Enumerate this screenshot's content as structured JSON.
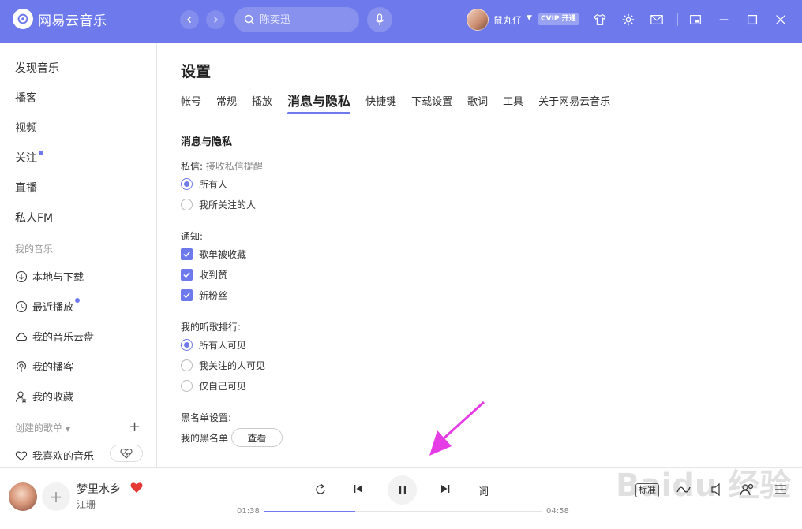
{
  "header": {
    "app_name": "网易云音乐",
    "search_placeholder": "陈奕迅",
    "username": "鼠丸仔",
    "vip_badge": "CVIP 开通",
    "accent": "#6e79eb"
  },
  "sidebar": {
    "items": [
      {
        "label": "发现音乐"
      },
      {
        "label": "播客"
      },
      {
        "label": "视频"
      },
      {
        "label": "关注"
      },
      {
        "label": "直播"
      },
      {
        "label": "私人FM"
      }
    ],
    "my_music_title": "我的音乐",
    "my_music": [
      {
        "label": "本地与下载",
        "icon": "download-icon"
      },
      {
        "label": "最近播放",
        "icon": "clock-icon"
      },
      {
        "label": "我的音乐云盘",
        "icon": "cloud-icon"
      },
      {
        "label": "我的播客",
        "icon": "podcast-icon"
      },
      {
        "label": "我的收藏",
        "icon": "star-user-icon"
      }
    ],
    "playlists_title": "创建的歌单",
    "favorite_playlist": "我喜欢的音乐"
  },
  "settings": {
    "title": "设置",
    "tabs": [
      "帐号",
      "常规",
      "播放",
      "消息与隐私",
      "快捷键",
      "下载设置",
      "歌词",
      "工具",
      "关于网易云音乐"
    ],
    "active_tab": "消息与隐私",
    "section_title": "消息与隐私",
    "dm_label": "私信:",
    "dm_hint": "接收私信提醒",
    "dm_options": [
      "所有人",
      "我所关注的人"
    ],
    "notify_label": "通知:",
    "notify_options": [
      "歌单被收藏",
      "收到赞",
      "新粉丝"
    ],
    "ranking_label": "我的听歌排行:",
    "ranking_options": [
      "所有人可见",
      "我关注的人可见",
      "仅自己可见"
    ],
    "blacklist_label": "黑名单设置:",
    "blacklist_text": "我的黑名单",
    "view_button": "查看"
  },
  "player": {
    "song": "梦里水乡",
    "artist": "江珊",
    "current_time": "01:38",
    "total_time": "04:58",
    "progress": 0.33,
    "quality": "标准",
    "lyric_button": "词",
    "watermark": "Baidu 经验"
  }
}
